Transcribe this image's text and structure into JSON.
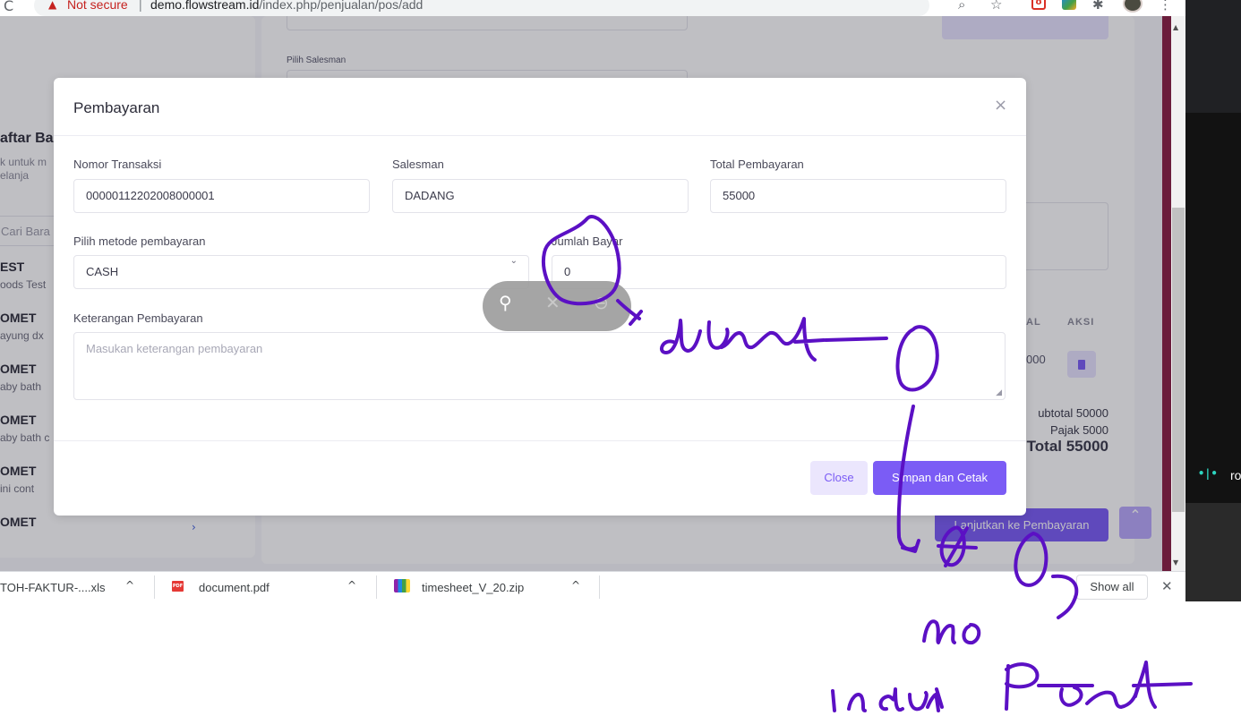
{
  "browser": {
    "not_secure": "Not secure",
    "separator": "|",
    "url_host": "demo.flowstream.id",
    "url_path": "/index.php/penjualan/pos/add",
    "icons": [
      "reload-icon",
      "warning-icon",
      "zoom-icon",
      "star-icon",
      "extension-icon",
      "puzzle-icon",
      "avatar",
      "menu-icon"
    ]
  },
  "page": {
    "salesman_label": "Pilih Salesman",
    "left_title": "aftar Ba",
    "left_sub_1": "k untuk m",
    "left_sub_2": "elanja",
    "left_search": "Cari Bara",
    "products": [
      {
        "name": "EST",
        "desc": "oods Test"
      },
      {
        "name": "OMET",
        "desc": "ayung dx"
      },
      {
        "name": "OMET",
        "desc": "aby bath"
      },
      {
        "name": "OMET",
        "desc": "aby bath c"
      },
      {
        "name": "OMET",
        "desc": "ini cont"
      },
      {
        "name": "OMET",
        "desc": ""
      }
    ],
    "table_headers": {
      "total": "AL",
      "action": "AKSI"
    },
    "row_total": "000",
    "subtotal": "ubtotal 50000",
    "pajak": "Pajak 5000",
    "total": "Total 55000",
    "continue_button": "Lanjutkan ke Pembayaran",
    "recording_label": "ro"
  },
  "modal": {
    "title": "Pembayaran",
    "close_symbol": "×",
    "nomor_label": "Nomor Transaksi",
    "nomor_value": "00000112202008000001",
    "salesman_label": "Salesman",
    "salesman_value": "DADANG",
    "total_label": "Total Pembayaran",
    "total_value": "55000",
    "metode_label": "Pilih metode pembayaran",
    "metode_value": "CASH",
    "jumlah_label": "Jumlah Bayar",
    "jumlah_value": "0",
    "keterangan_label": "Keterangan Pembayaran",
    "keterangan_placeholder": "Masukan keterangan pembayaran",
    "close_button": "Close",
    "save_button": "Simpan dan Cetak"
  },
  "floating_toolbar": {
    "icons": [
      "pin-icon",
      "mute-icon",
      "minus-icon"
    ]
  },
  "downloads": {
    "items": [
      {
        "name": "TOH-FAKTUR-....xls"
      },
      {
        "name": "document.pdf"
      },
      {
        "name": "timesheet_V_20.zip"
      }
    ],
    "show_all": "Show all"
  },
  "handwriting": {
    "words": [
      "dibuat",
      "no",
      "induk",
      "Pajak"
    ],
    "ink_color": "#5b10c4"
  },
  "colors": {
    "accent": "#7b5cf5",
    "accent_light": "#ebe6fd",
    "warning": "#c5221f"
  }
}
